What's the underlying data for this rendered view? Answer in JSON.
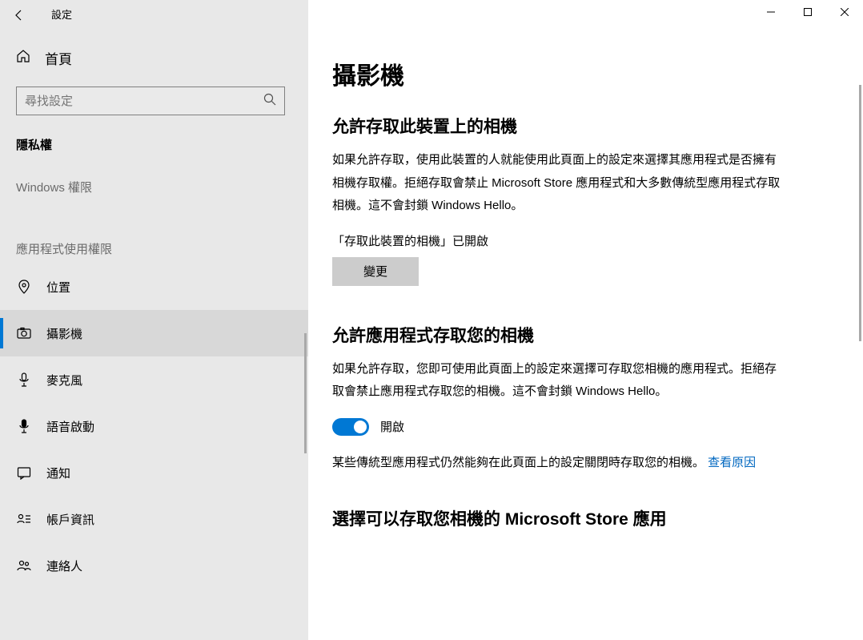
{
  "titlebar": {
    "title": "設定"
  },
  "sidebar": {
    "home": "首頁",
    "search_placeholder": "尋找設定",
    "category": "隱私權",
    "windows_perm": "Windows 權限",
    "app_perm_header": "應用程式使用權限",
    "items": [
      {
        "label": "位置"
      },
      {
        "label": "攝影機"
      },
      {
        "label": "麥克風"
      },
      {
        "label": "語音啟動"
      },
      {
        "label": "通知"
      },
      {
        "label": "帳戶資訊"
      },
      {
        "label": "連絡人"
      }
    ]
  },
  "content": {
    "page_title": "攝影機",
    "section1": {
      "title": "允許存取此裝置上的相機",
      "desc": "如果允許存取，使用此裝置的人就能使用此頁面上的設定來選擇其應用程式是否擁有相機存取權。拒絕存取會禁止 Microsoft Store 應用程式和大多數傳統型應用程式存取相機。這不會封鎖 Windows Hello。",
      "status": "「存取此裝置的相機」已開啟",
      "change": "變更"
    },
    "section2": {
      "title": "允許應用程式存取您的相機",
      "desc": "如果允許存取，您即可使用此頁面上的設定來選擇可存取您相機的應用程式。拒絕存取會禁止應用程式存取您的相機。這不會封鎖 Windows Hello。",
      "toggle_label": "開啟",
      "note_prefix": "某些傳統型應用程式仍然能夠在此頁面上的設定關閉時存取您的相機。 ",
      "note_link": "查看原因"
    },
    "section3": {
      "title": "選擇可以存取您相機的 Microsoft Store 應用"
    }
  }
}
